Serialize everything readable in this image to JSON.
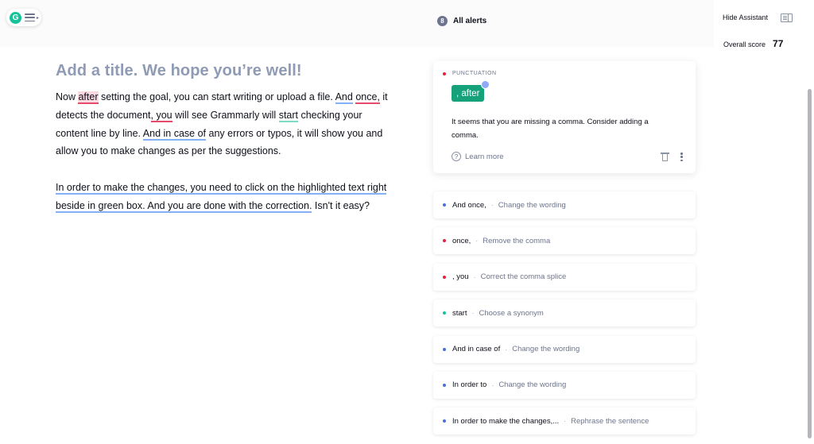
{
  "header": {
    "logo_letter": "G",
    "alert_count": "8",
    "alerts_title": "All alerts"
  },
  "assistant": {
    "hide_label": "Hide Assistant",
    "overall_score_label": "Overall score",
    "overall_score_value": "77"
  },
  "document": {
    "title": "Add a title. We hope you’re well!",
    "p1": {
      "t1": "Now ",
      "w_after": "after",
      "t2": " setting the goal, you can start writing or upload a file. ",
      "w_and_once_1": "And",
      "t3": " ",
      "w_and_once_2": "once,",
      "t4": " it detects the document",
      "w_comma_you": ", you",
      "t5": " will see Grammarly will ",
      "w_start": "start",
      "t6": " checking your content line by line. ",
      "w_in_case": "And in case of",
      "t7": " any errors or typos, it will show you and allow you to make changes as per the suggestions."
    },
    "p2": {
      "w_in_order": "In order to",
      "w_rest": " make the changes, you need to click on the highlighted text right beside in green box. And you are done with the correction.",
      "t_end": " Isn't it easy?"
    }
  },
  "active_card": {
    "category": "PUNCTUATION",
    "suggestion": ", after",
    "message": "It seems that you are missing a comma. Consider adding a comma.",
    "learn_more": "Learn more",
    "icons": [
      "question-icon",
      "trash-icon",
      "more-icon"
    ]
  },
  "alerts": [
    {
      "word": "And once,",
      "action": "Change the wording",
      "color": "#4a6ee0"
    },
    {
      "word": "once,",
      "action": "Remove the comma",
      "color": "#e2233e"
    },
    {
      "word": ", you",
      "action": "Correct the comma splice",
      "color": "#e2233e"
    },
    {
      "word": "start",
      "action": "Choose a synonym",
      "color": "#15c39a"
    },
    {
      "word": "And in case of",
      "action": "Change the wording",
      "color": "#4a6ee0"
    },
    {
      "word": "In order to",
      "action": "Change the wording",
      "color": "#4a6ee0"
    },
    {
      "word": "In order to make the changes,...",
      "action": "Rephrase the sentence",
      "color": "#4a6ee0"
    }
  ],
  "separator": "·",
  "colors": {
    "accent_green": "#15c39a",
    "suggestion_green": "#15a27a",
    "correctness_red": "#e2233e",
    "clarity_blue": "#4a6ee0",
    "title_gray": "#8f9ab5"
  }
}
